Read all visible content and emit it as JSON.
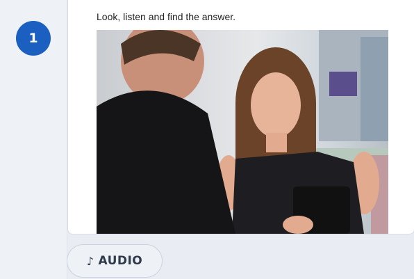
{
  "question": {
    "number": "1",
    "prompt": "Look, listen and find the answer."
  },
  "image": {
    "content": "photo-woman-smiling-with-tablet-talking-to-man"
  },
  "audio_button": {
    "icon": "music-note-icon",
    "label": "AUDIO"
  },
  "colors": {
    "accent": "#1b5fc1",
    "background": "#e9edf3",
    "card": "#ffffff"
  }
}
